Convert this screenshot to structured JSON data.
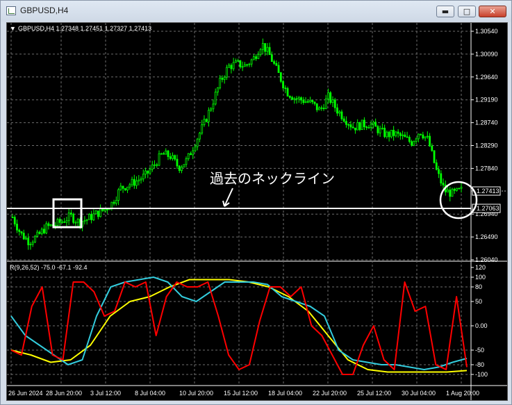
{
  "window": {
    "title": "GBPUSD,H4",
    "buttons": {
      "minimize": "▬",
      "maximize": "□",
      "close": "✕"
    }
  },
  "chart": {
    "header": "GBPUSD,H4  1.27348 1.27451 1.27327 1.27413",
    "annotation": "過去のネックライン",
    "current_price_label": "1.27413",
    "line_price_label": "1.27063",
    "colors": {
      "background": "#000000",
      "candle": "#00ff00",
      "grid": "#6e6e6e",
      "neckline": "#ffffff"
    }
  },
  "indicator": {
    "label": "R(9,26,52) -75.0 -67.1 -92.4",
    "colors": {
      "fast": "#ff0000",
      "mid": "#33ccdd",
      "slow": "#ffff00"
    }
  },
  "chart_data": {
    "type": "candlestick",
    "symbol": "GBPUSD",
    "timeframe": "H4",
    "price_ticks": [
      "1.30540",
      "1.30090",
      "1.29640",
      "1.29190",
      "1.28740",
      "1.28290",
      "1.27840",
      "1.26940",
      "1.26490",
      "1.26040"
    ],
    "date_ticks": [
      "26 Jun 2024",
      "28 Jun 20:00",
      "3 Jul 12:00",
      "8 Jul 04:00",
      "10 Jul 20:00",
      "15 Jul 12:00",
      "18 Jul 04:00",
      "22 Jul 20:00",
      "25 Jul 12:00",
      "30 Jul 04:00",
      "1 Aug 20:00"
    ],
    "ylim": [
      1.2604,
      1.3054
    ],
    "close_path": [
      1.2688,
      1.2655,
      1.264,
      1.265,
      1.2668,
      1.2672,
      1.268,
      1.269,
      1.2678,
      1.2684,
      1.2694,
      1.2702,
      1.2716,
      1.2745,
      1.2752,
      1.276,
      1.277,
      1.279,
      1.2812,
      1.2808,
      1.2786,
      1.28,
      1.2836,
      1.287,
      1.291,
      1.2955,
      1.2985,
      1.299,
      1.2986,
      1.3,
      1.303,
      1.3005,
      1.297,
      1.2935,
      1.2922,
      1.2918,
      1.2912,
      1.2898,
      1.2925,
      1.29,
      1.2882,
      1.2865,
      1.287,
      1.2872,
      1.286,
      1.285,
      1.2852,
      1.2845,
      1.2835,
      1.2858,
      1.284,
      1.278,
      1.274,
      1.2734,
      1.2741
    ],
    "neckline": 1.27063,
    "last_price": 1.27413,
    "indicator": {
      "name": "R(9,26,52)",
      "values_shown": [
        -75.0,
        -67.1,
        -92.4
      ],
      "ylim": [
        -120,
        120
      ],
      "ticks": [
        "120",
        "100",
        "80",
        "50",
        "0.00",
        "-50",
        "-80",
        "-100"
      ],
      "fast": [
        -50,
        -60,
        40,
        80,
        -60,
        -70,
        90,
        90,
        70,
        20,
        30,
        90,
        80,
        90,
        -20,
        60,
        90,
        80,
        80,
        90,
        20,
        -60,
        -90,
        -80,
        10,
        80,
        80,
        60,
        80,
        0,
        -20,
        -60,
        -100,
        -100,
        -40,
        0,
        -70,
        -90,
        90,
        30,
        40,
        -80,
        -90,
        60,
        -85
      ],
      "mid": [
        20,
        -20,
        -40,
        -60,
        -80,
        -70,
        20,
        80,
        90,
        95,
        100,
        90,
        60,
        50,
        70,
        90,
        90,
        90,
        85,
        60,
        50,
        40,
        20,
        -50,
        -70,
        -75,
        -80,
        -80,
        -85,
        -90,
        -85,
        -75,
        -67
      ],
      "slow": [
        -50,
        -60,
        -75,
        -70,
        -40,
        20,
        50,
        60,
        80,
        95,
        95,
        95,
        90,
        80,
        60,
        30,
        -20,
        -70,
        -90,
        -95,
        -95,
        -95,
        -95,
        -92
      ]
    }
  }
}
